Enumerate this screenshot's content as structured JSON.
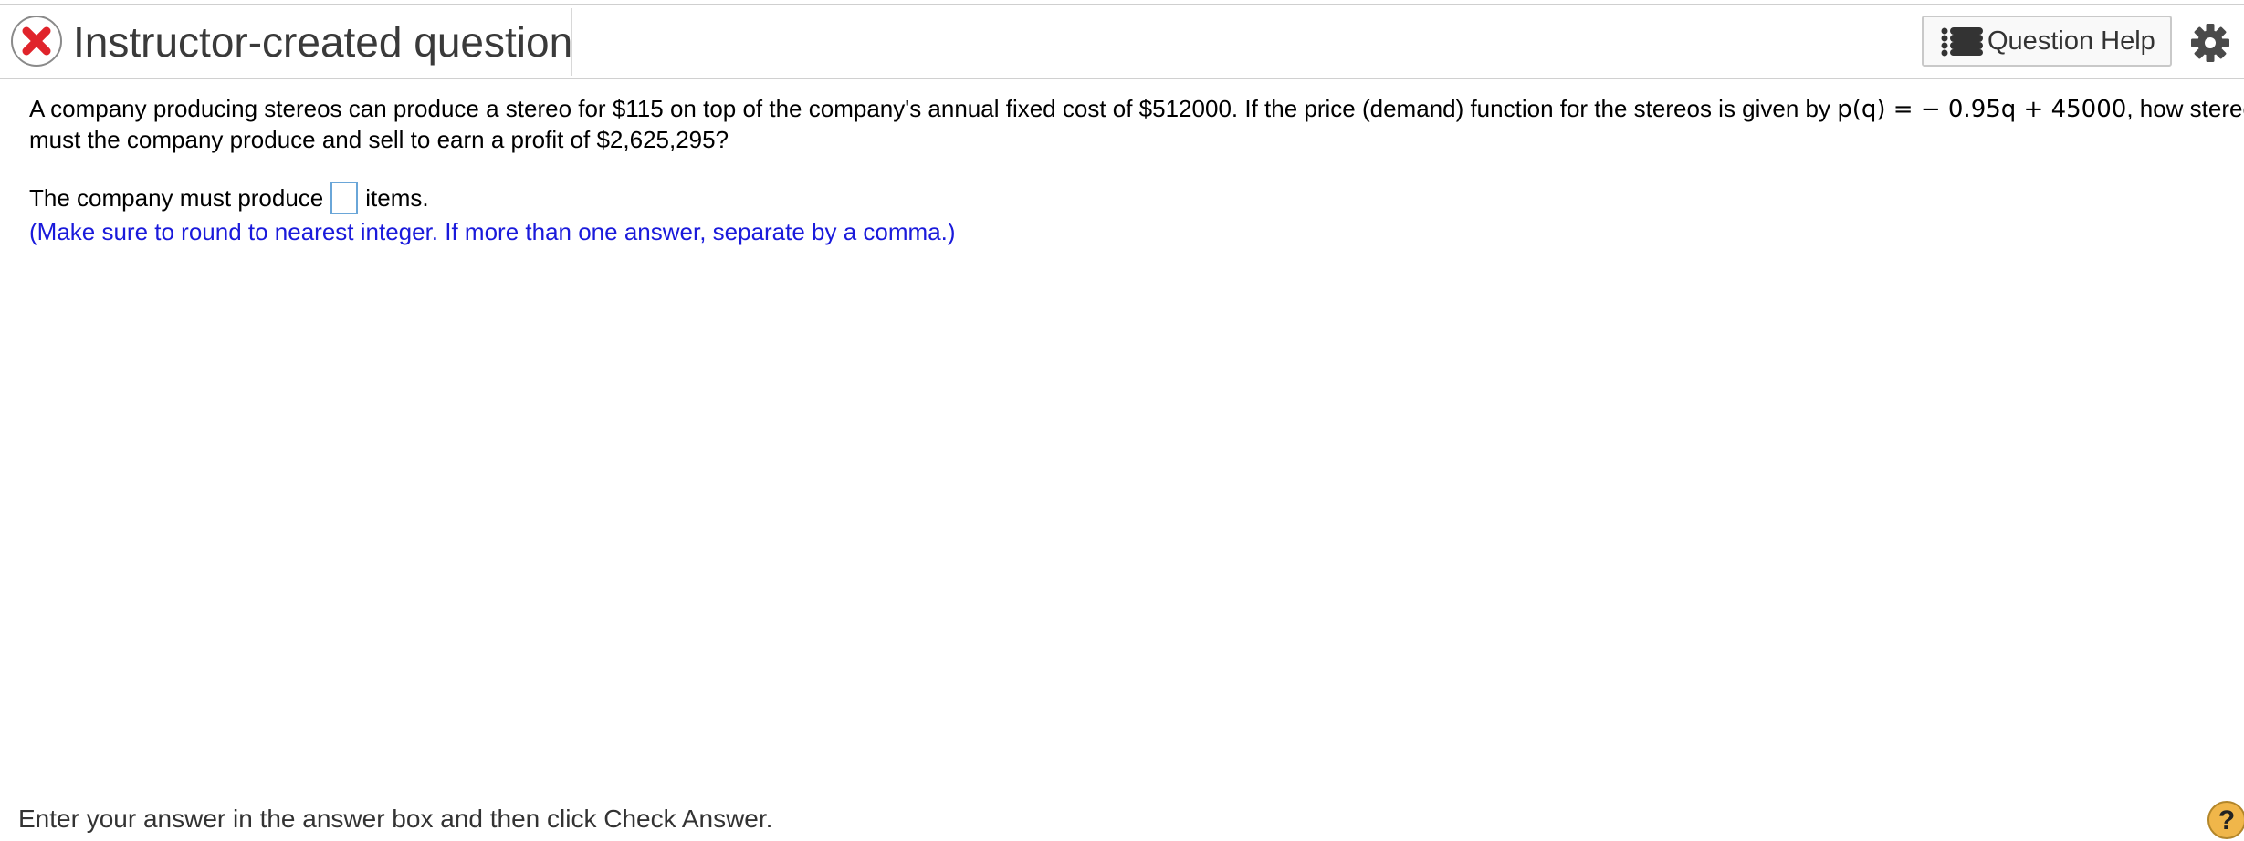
{
  "header": {
    "title": "Instructor-created question",
    "status_icon": "x-circle-icon",
    "help_button_label": "Question Help",
    "help_button_icon": "list-icon",
    "settings_icon": "gear-icon"
  },
  "question": {
    "text_before_math": "A company producing stereos can produce a stereo for $115 on top of the company's annual fixed cost of $512000.  If the price (demand) function for the stereos is given by ",
    "math": "p(q) = − 0.95q + 45000",
    "text_line1_end": ", how stereos",
    "text_line2": "must the company produce and sell to earn a profit of $2,625,295?"
  },
  "answer": {
    "prefix": "The company must produce",
    "value": "",
    "suffix": "items."
  },
  "hint": "(Make sure to round to nearest integer.  If more than one answer, separate by a comma.)",
  "footer": {
    "instruction": "Enter your answer in the answer box and then click Check Answer.",
    "help_symbol": "?"
  },
  "colors": {
    "hint_text": "#1a1adb",
    "status_icon_red": "#e0242b",
    "answer_box_border": "#6aa6d8",
    "help_circle": "#f0b64a"
  }
}
